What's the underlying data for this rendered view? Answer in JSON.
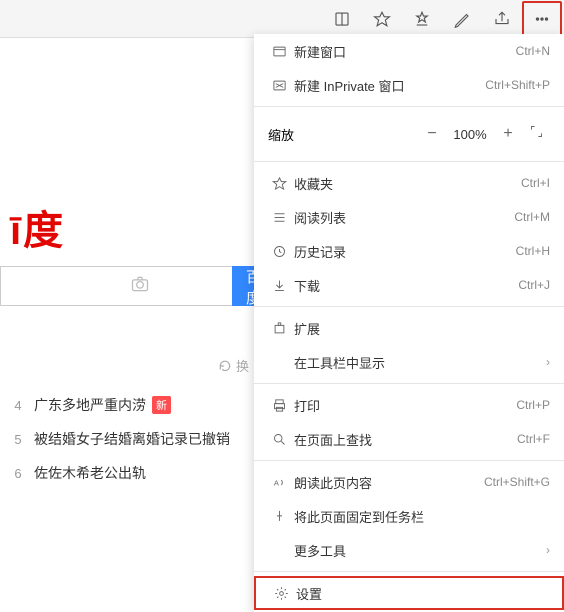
{
  "toolbar": {
    "icons": [
      "reading-view-icon",
      "star-icon",
      "favorites-icon",
      "notes-icon",
      "share-icon",
      "more-icon"
    ]
  },
  "page": {
    "logo_fragment": "ī度",
    "search_placeholder": "",
    "search_button": "百度一",
    "refresh_hint": "换",
    "hot": [
      {
        "num": "4",
        "title": "广东多地严重内涝",
        "badge": "新"
      },
      {
        "num": "5",
        "title": "被结婚女子结婚离婚记录已撤销",
        "badge": ""
      },
      {
        "num": "6",
        "title": "佐佐木希老公出轨",
        "badge": ""
      }
    ]
  },
  "menu": {
    "new_window": "新建窗口",
    "new_window_sc": "Ctrl+N",
    "new_inprivate": "新建 InPrivate 窗口",
    "new_inprivate_sc": "Ctrl+Shift+P",
    "zoom_label": "缩放",
    "zoom_value": "100%",
    "favorites": "收藏夹",
    "favorites_sc": "Ctrl+I",
    "reading_list": "阅读列表",
    "reading_list_sc": "Ctrl+M",
    "history": "历史记录",
    "history_sc": "Ctrl+H",
    "downloads": "下载",
    "downloads_sc": "Ctrl+J",
    "extensions": "扩展",
    "show_in_toolbar": "在工具栏中显示",
    "print": "打印",
    "print_sc": "Ctrl+P",
    "find": "在页面上查找",
    "find_sc": "Ctrl+F",
    "read_aloud": "朗读此页内容",
    "read_aloud_sc": "Ctrl+Shift+G",
    "pin_taskbar": "将此页面固定到任务栏",
    "more_tools": "更多工具",
    "settings": "设置"
  }
}
